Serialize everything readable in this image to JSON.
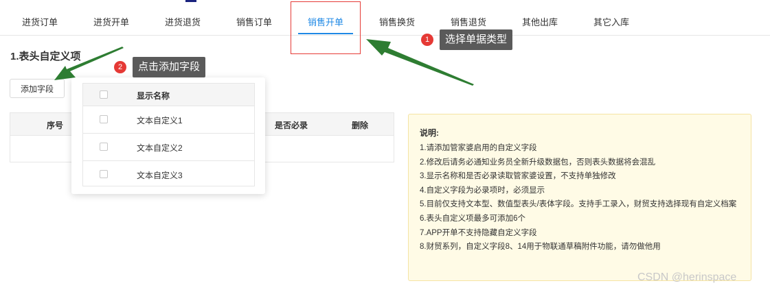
{
  "tabs": [
    {
      "label": "进货订单"
    },
    {
      "label": "进货开单"
    },
    {
      "label": "进货退货"
    },
    {
      "label": "销售订单"
    },
    {
      "label": "销售开单",
      "active": true
    },
    {
      "label": "销售换货"
    },
    {
      "label": "销售退货"
    },
    {
      "label": "其他出库"
    },
    {
      "label": "其它入库"
    }
  ],
  "section": {
    "title": "1.表头自定义项",
    "add_button": "添加字段"
  },
  "table": {
    "columns": [
      "序号",
      "是否必录",
      "删除"
    ]
  },
  "popup": {
    "header": "显示名称",
    "options": [
      "文本自定义1",
      "文本自定义2",
      "文本自定义3"
    ]
  },
  "notes": {
    "title": "说明:",
    "items": [
      "1.请添加管家婆启用的自定义字段",
      "2.修改后请务必通知业务员全新升级数据包，否则表头数据将会混乱",
      "3.显示名称和是否必录读取管家婆设置，不支持单独修改",
      "4.自定义字段为必录项时，必须显示",
      "5.目前仅支持文本型、数值型表头/表体字段。支持手工录入，财贸支持选择现有自定义档案",
      "6.表头自定义项最多可添加6个",
      "7.APP开单不支持隐藏自定义字段",
      "8.财贸系列，自定义字段8、14用于物联通草稿附件功能，请勿做他用"
    ]
  },
  "callouts": [
    {
      "number": "1",
      "text": "选择单据类型"
    },
    {
      "number": "2",
      "text": "点击添加字段"
    }
  ],
  "colors": {
    "accent": "#1e88e5",
    "annotation_red": "#e53935",
    "arrow_green": "#2e7d32",
    "notes_bg": "#fffbe6"
  },
  "watermark": "CSDN @herinspace"
}
